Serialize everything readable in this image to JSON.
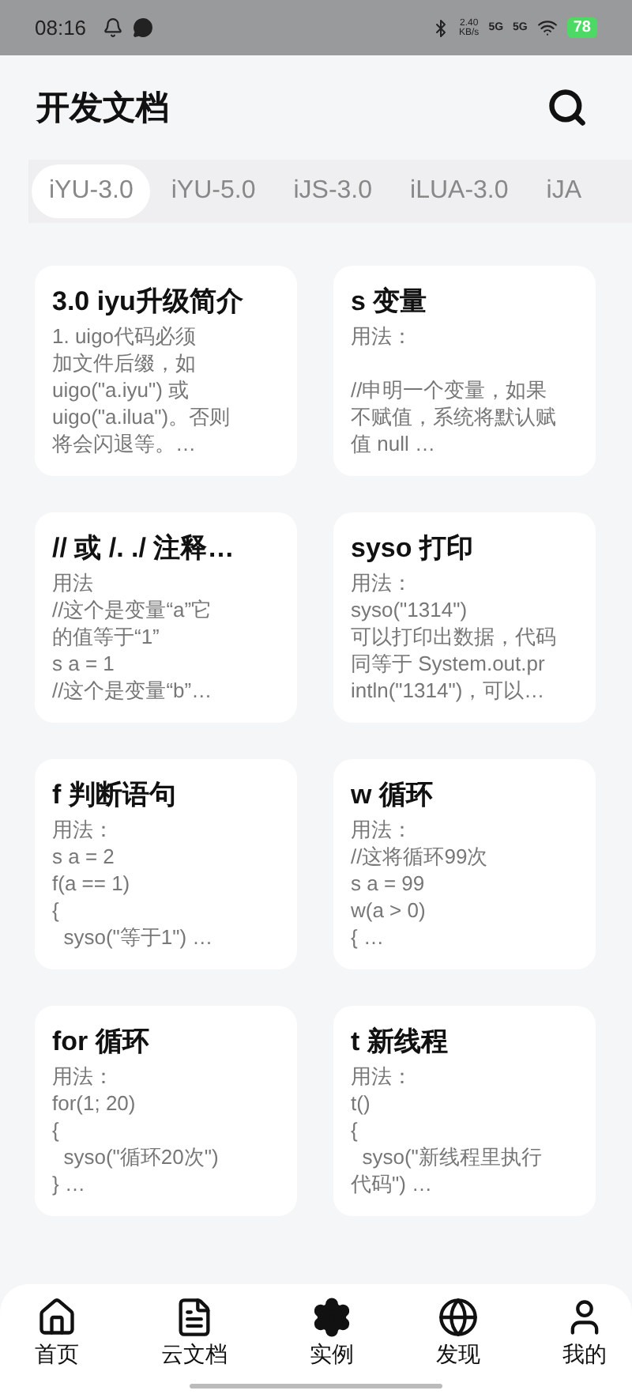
{
  "status_bar": {
    "time": "08:16",
    "speed": "2.40\nKB/s",
    "network_1": "5G",
    "network_2": "5G",
    "battery": "78"
  },
  "header": {
    "title": "开发文档"
  },
  "tabs": [
    {
      "label": "iYU-3.0",
      "selected": true
    },
    {
      "label": "iYU-5.0",
      "selected": false
    },
    {
      "label": "iJS-3.0",
      "selected": false
    },
    {
      "label": "iLUA-3.0",
      "selected": false
    },
    {
      "label": "iJA",
      "selected": false
    }
  ],
  "cards": [
    {
      "title": "3.0 iyu升级简介",
      "lines": [
        "1. uigo代码必须",
        "加文件后缀，如",
        "uigo(\"a.iyu\") 或",
        "uigo(\"a.ilua\")。否则",
        "将会闪退等。…"
      ]
    },
    {
      "title": "s 变量",
      "lines": [
        "用法："
      ],
      "paragraph_2": [
        "//申明一个变量，如果",
        "不赋值，系统将默认赋",
        "值 null …"
      ]
    },
    {
      "title": "// 或 /. ./ 注释…",
      "lines": [
        "用法",
        "//这个是变量“a”它",
        "的值等于“1”",
        "s a = 1",
        "//这个是变量“b”…"
      ]
    },
    {
      "title": "syso 打印",
      "lines": [
        "用法：",
        "syso(\"1314\")",
        "可以打印出数据，代码",
        "同等于 System.out.pr",
        "intln(\"1314\")，可以…"
      ]
    },
    {
      "title": "f 判断语句",
      "lines": [
        "用法：",
        "s a = 2",
        "f(a == 1)",
        "{",
        "  syso(\"等于1\") …"
      ]
    },
    {
      "title": "w 循环",
      "lines": [
        "用法：",
        "//这将循环99次",
        "s a = 99",
        "w(a > 0)",
        "{ …"
      ]
    },
    {
      "title": "for 循环",
      "lines": [
        "用法：",
        "for(1; 20)",
        "{",
        "  syso(\"循环20次\")",
        "} …"
      ]
    },
    {
      "title": "t 新线程",
      "lines": [
        "用法：",
        "t()",
        "{",
        "  syso(\"新线程里执行",
        "代码\") …"
      ]
    }
  ],
  "bottom_nav": [
    {
      "label": "首页",
      "kind": "home",
      "selected": false
    },
    {
      "label": "云文档",
      "kind": "doc",
      "selected": false
    },
    {
      "label": "实例",
      "kind": "gear",
      "selected": true
    },
    {
      "label": "发现",
      "kind": "globe",
      "selected": false
    },
    {
      "label": "我的",
      "kind": "user",
      "selected": false
    }
  ]
}
